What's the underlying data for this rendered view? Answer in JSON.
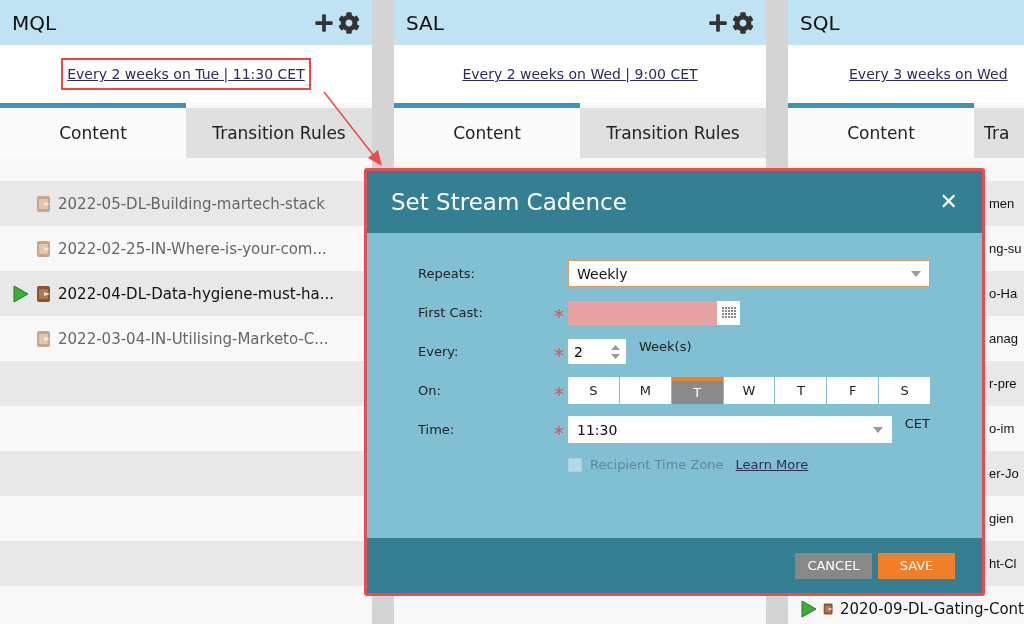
{
  "columns": [
    {
      "title": "MQL",
      "actions": true,
      "cadence": "Every 2 weeks on Tue | 11:30 CET",
      "highlighted": true,
      "tabs": [
        {
          "label": "Content",
          "selected": true
        },
        {
          "label": "Transition Rules",
          "selected": false
        }
      ],
      "rows": [
        {
          "kind": "full",
          "text": "2022-05-DL-Building-martech-stack",
          "active": false
        },
        {
          "kind": "full",
          "text": "2022-02-25-IN-Where-is-your-com...",
          "active": false
        },
        {
          "kind": "full",
          "text": "2022-04-DL-Data-hygiene-must-ha...",
          "active": true
        },
        {
          "kind": "full",
          "text": "2022-03-04-IN-Utilising-Marketo-C...",
          "active": false
        }
      ]
    },
    {
      "title": "SAL",
      "actions": true,
      "cadence": "Every 2 weeks on Wed | 9:00 CET",
      "highlighted": false,
      "tabs": [
        {
          "label": "Content",
          "selected": true
        },
        {
          "label": "Transition Rules",
          "selected": false
        }
      ]
    },
    {
      "title": "SQL",
      "actions": false,
      "cadence": "Every 3 weeks on Wed",
      "highlighted": false,
      "tabs": [
        {
          "label": "Content",
          "selected": true
        },
        {
          "label": "Tra",
          "selected": false
        }
      ],
      "rows": [
        {
          "kind": "partial",
          "text": "men"
        },
        {
          "kind": "partial",
          "text": "ng-su"
        },
        {
          "kind": "partial",
          "text": "o-Ha"
        },
        {
          "kind": "partial",
          "text": "anag"
        },
        {
          "kind": "partial",
          "text": "r-pre"
        },
        {
          "kind": "partial",
          "text": "o-im"
        },
        {
          "kind": "partial",
          "text": "er-Jo"
        },
        {
          "kind": "partial",
          "text": "gien"
        },
        {
          "kind": "partial",
          "text": "ht-Cl"
        },
        {
          "kind": "full",
          "text": "2020-09-DL-Gating-Cont",
          "active": true
        }
      ]
    }
  ],
  "dialog": {
    "title": "Set Stream Cadence",
    "close": "✕",
    "repeats": {
      "label": "Repeats:",
      "value": "Weekly"
    },
    "first_cast": {
      "label": "First Cast:",
      "invalid": true
    },
    "every": {
      "label": "Every:",
      "value": "2",
      "unit": "Week(s)"
    },
    "on": {
      "label": "On:",
      "days": [
        {
          "label": "S",
          "selected": false
        },
        {
          "label": "M",
          "selected": false
        },
        {
          "label": "T",
          "selected": true
        },
        {
          "label": "W",
          "selected": false
        },
        {
          "label": "T",
          "selected": false
        },
        {
          "label": "F",
          "selected": false
        },
        {
          "label": "S",
          "selected": false
        }
      ]
    },
    "time": {
      "label": "Time:",
      "value": "11:30",
      "zone": "CET"
    },
    "recipient_time_zone": {
      "label": "Recipient Time Zone",
      "checked": false,
      "disabled": true
    },
    "learn_more": "Learn More",
    "required_mark": "*",
    "buttons": [
      {
        "label": "CANCEL",
        "kind": "secondary"
      },
      {
        "label": "SAVE",
        "kind": "primary"
      }
    ]
  }
}
